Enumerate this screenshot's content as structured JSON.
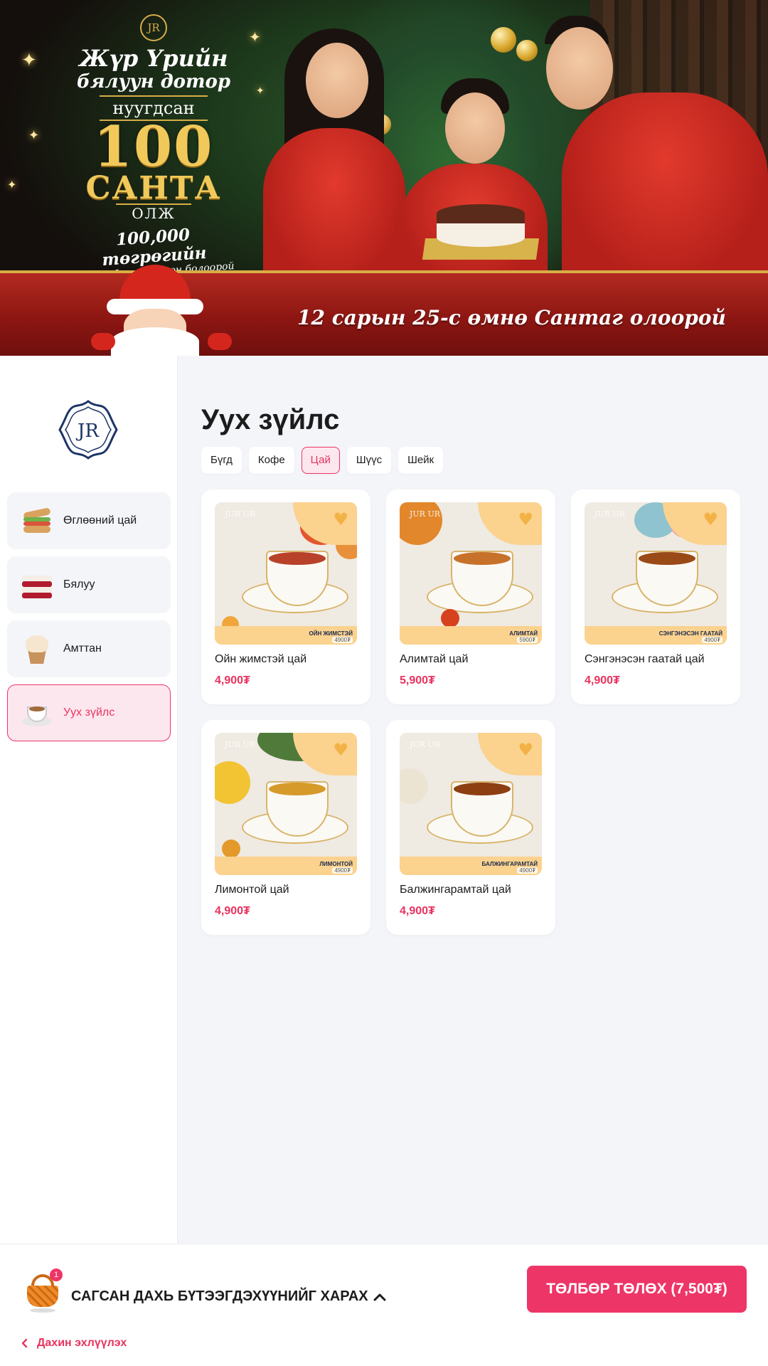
{
  "banner": {
    "promo_line1": "Жүр Үрийн",
    "promo_line2": "бялуун дотор",
    "promo_line3": "нуугдсан",
    "promo_big_number": "100",
    "promo_big_word": "САНТА",
    "promo_line4": "ОЛЖ",
    "promo_prize": "100,000 төгрөгийн",
    "promo_prize_sub": "эрхийн бичгийн эзэн болоорой",
    "ribbon_text": "12 сарын 25-с өмнө Сантаг олоорой",
    "logo_mark": "JR"
  },
  "sidebar": {
    "logo": "JR",
    "categories": [
      {
        "label": "Өглөөний цай",
        "icon": "sandwich-icon"
      },
      {
        "label": "Бялуу",
        "icon": "cake-icon"
      },
      {
        "label": "Амттан",
        "icon": "cupcake-icon"
      },
      {
        "label": "Ууx зүйлс",
        "icon": "coffee-cup-icon",
        "active": true
      }
    ]
  },
  "main": {
    "title": "Ууx зүйлс",
    "filters": [
      {
        "label": "Бүгд"
      },
      {
        "label": "Кофе"
      },
      {
        "label": "Цай",
        "active": true
      },
      {
        "label": "Шүүс"
      },
      {
        "label": "Шейк"
      }
    ],
    "products": [
      {
        "name": "Ойн жимстэй цай",
        "price": "4,900₮",
        "img_label": "ОЙН ЖИМСТЭЙ",
        "img_price": "4900₮",
        "tea_color": "#b8412a"
      },
      {
        "name": "Алимтай цай",
        "price": "5,900₮",
        "img_label": "АЛИМТАЙ",
        "img_price": "5900₮",
        "tea_color": "#c7722a"
      },
      {
        "name": "Сэнгэнэсэн гаатай цай",
        "price": "4,900₮",
        "img_label": "СЭНГЭНЭСЭН ГААТАЙ",
        "img_price": "4900₮",
        "tea_color": "#9a4a17"
      },
      {
        "name": "Лимонтой цай",
        "price": "4,900₮",
        "img_label": "ЛИМОНТОЙ",
        "img_price": "4900₮",
        "tea_color": "#d69a2a"
      },
      {
        "name": "Балжингарамтай цай",
        "price": "4,900₮",
        "img_label": "БАЛЖИНГАРАМТАЙ",
        "img_price": "4900₮",
        "tea_color": "#8d3f12"
      }
    ]
  },
  "footer": {
    "cart_count": "1",
    "cart_label": "САГСАН ДАХЬ БҮТЭЭГДЭХҮҮНИЙГ ХАРАХ",
    "pay_button": "ТӨЛБӨР ТӨЛӨХ (7,500₮)",
    "back_label": "Дахин эхлүүлэх"
  },
  "colors": {
    "accent": "#ee3567",
    "accent_bg": "#fde7ee",
    "page_bg": "#f4f5f9",
    "gold": "#d8ad46"
  }
}
